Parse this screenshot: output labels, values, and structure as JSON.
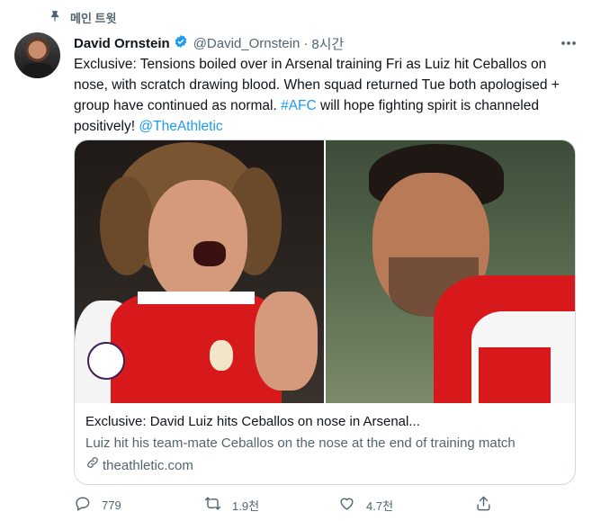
{
  "pinned": {
    "label": "메인 트윗",
    "icon": "pin-icon"
  },
  "author": {
    "name": "David Ornstein",
    "verified_icon": "verified-badge-icon",
    "handle": "@David_Ornstein",
    "separator": "·",
    "time": "8시간"
  },
  "more_icon": "more-icon",
  "tweet": {
    "text_part1": "Exclusive: Tensions boiled over in Arsenal training Fri as Luiz hit Ceballos on nose, with scratch drawing blood. When squad returned Tue both apologised + group have continued as normal. ",
    "hashtag": "#AFC",
    "text_part2": " will hope fighting spirit is channeled positively! ",
    "mention": "@TheAthletic"
  },
  "card": {
    "title": "Exclusive: David Luiz hits Ceballos on nose in Arsenal...",
    "description": "Luiz hit his team-mate Ceballos on the nose at the end of training match",
    "domain": "theathletic.com",
    "link_icon": "link-icon"
  },
  "actions": {
    "replies": "779",
    "retweets": "1.9천",
    "likes": "4.7천",
    "reply_icon": "reply-icon",
    "retweet_icon": "retweet-icon",
    "like_icon": "heart-icon",
    "share_icon": "share-icon"
  },
  "colors": {
    "accent": "#1d9bf0",
    "muted": "#536471",
    "text": "#0f1419",
    "border": "#cfd9de"
  }
}
